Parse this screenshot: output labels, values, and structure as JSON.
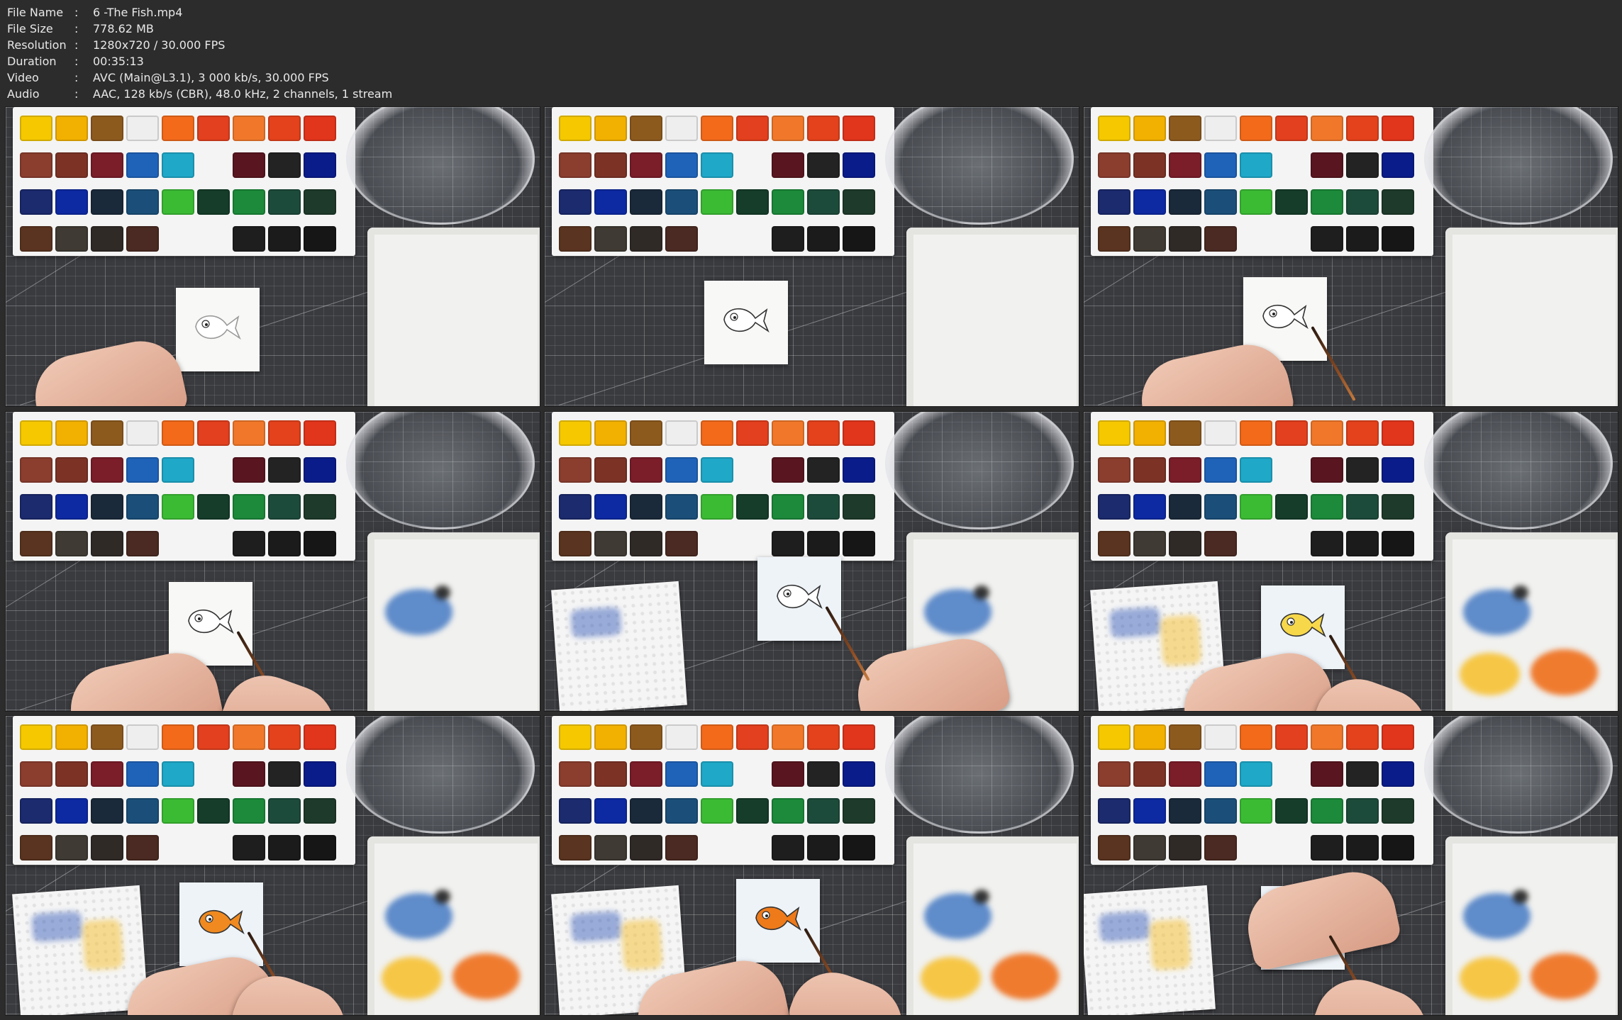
{
  "file_info": {
    "rows": [
      {
        "key": "File Name",
        "sep": ":",
        "value": "6 -The Fish.mp4"
      },
      {
        "key": "File Size",
        "sep": ":",
        "value": "778.62 MB"
      },
      {
        "key": "Resolution",
        "sep": ":",
        "value": "1280x720 / 30.000 FPS"
      },
      {
        "key": "Duration",
        "sep": ":",
        "value": "00:35:13"
      },
      {
        "key": "Video",
        "sep": ":",
        "value": "AVC (Main@L3.1), 3 000 kb/s, 30.000 FPS"
      },
      {
        "key": "Audio",
        "sep": ":",
        "value": "AAC, 128 kb/s (CBR), 48.0 kHz, 2 channels, 1 stream"
      }
    ]
  },
  "colors": {
    "background": "#2c2c2c",
    "text": "#e8e8e8",
    "mat": "#3a3b3f"
  },
  "palette_colors": [
    [
      "#f5c800",
      "#f2b100",
      "#8d5a1e",
      "#eeeeee",
      "#f36a1b",
      "#e2401e",
      "#f1782a",
      "#e3421c",
      "#e1351c"
    ],
    [
      "#8b3e2e",
      "#7c3326",
      "#7b1e2a",
      "#1f63b9",
      "#1fa8c8",
      "blank",
      "#5a1620",
      "#232323",
      "#0a1c8a"
    ],
    [
      "#1c2a6e",
      "#0d2aa3",
      "#1a2a3a",
      "#1b4f7a",
      "#3bbb34",
      "#163d2a",
      "#1c8a3a",
      "#1d4b3b",
      "#1e3a2a"
    ],
    [
      "#5a3420",
      "#3f3a33",
      "#2f2a26",
      "#4a2a22",
      "blank",
      "blank",
      "#1e1e1e",
      "#1b1b1b",
      "#161616"
    ]
  ],
  "frames": [
    {
      "stage": "pencil sketch",
      "has_towel": false,
      "paint_on_tray": false,
      "fish_color": "#ffffff"
    },
    {
      "stage": "inked sketch",
      "has_towel": false,
      "paint_on_tray": false,
      "fish_color": "#ffffff"
    },
    {
      "stage": "inked sketch with brush",
      "has_towel": false,
      "paint_on_tray": false,
      "fish_color": "#ffffff"
    },
    {
      "stage": "first blue wash",
      "has_towel": false,
      "paint_on_tray": true,
      "fish_color": "#ffffff"
    },
    {
      "stage": "background washed",
      "has_towel": true,
      "paint_on_tray": true,
      "fish_color": "#ffffff"
    },
    {
      "stage": "yellow base",
      "has_towel": true,
      "paint_on_tray": true,
      "fish_color": "#f7d84a"
    },
    {
      "stage": "orange layer",
      "has_towel": true,
      "paint_on_tray": true,
      "fish_color": "#f08a20"
    },
    {
      "stage": "orange detailing",
      "has_towel": true,
      "paint_on_tray": true,
      "fish_color": "#ee7a1a"
    },
    {
      "stage": "final details",
      "has_towel": true,
      "paint_on_tray": true,
      "fish_color": "#ee7a1a"
    }
  ]
}
